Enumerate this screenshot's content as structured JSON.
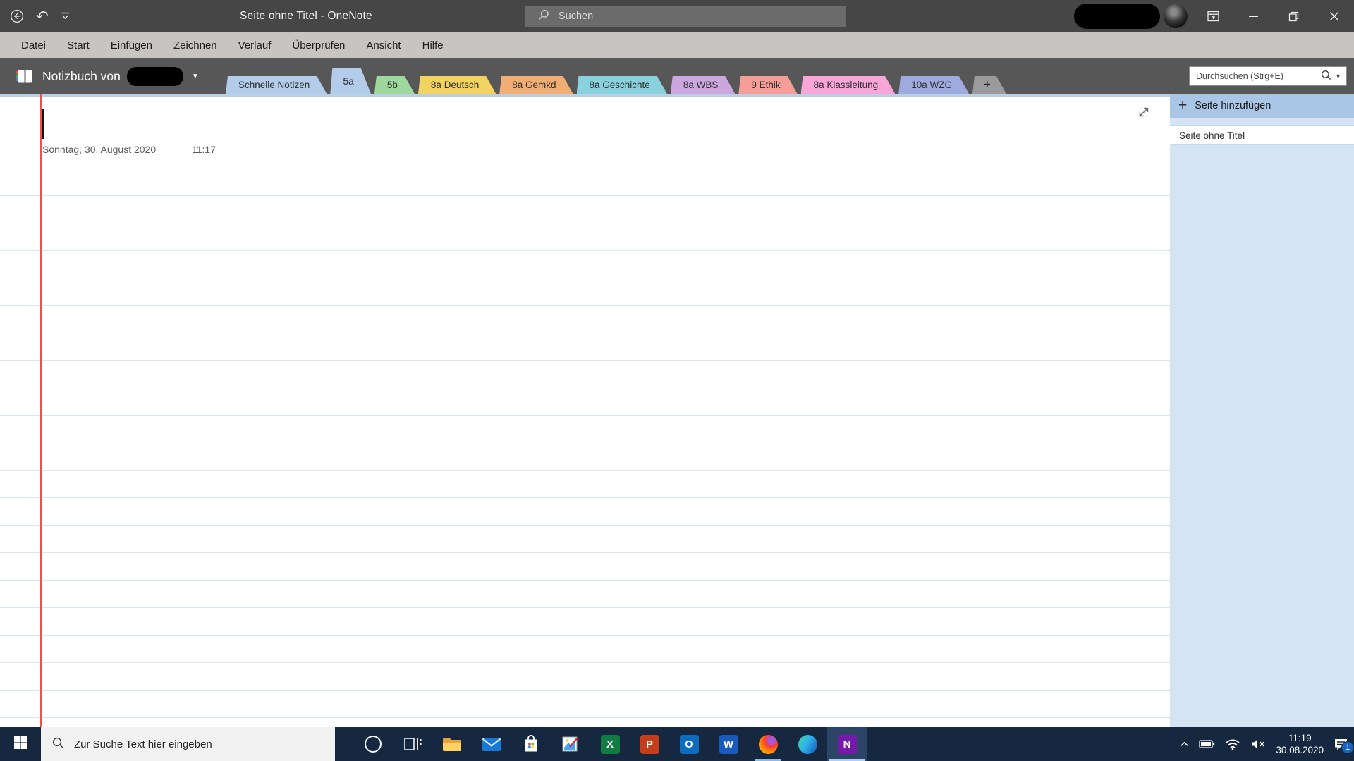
{
  "titlebar": {
    "title": "Seite ohne Titel  -  OneNote",
    "search_placeholder": "Suchen"
  },
  "menubar": {
    "items": [
      "Datei",
      "Start",
      "Einfügen",
      "Zeichnen",
      "Verlauf",
      "Überprüfen",
      "Ansicht",
      "Hilfe"
    ]
  },
  "notebook_bar": {
    "label": "Notizbuch von",
    "tabs": [
      {
        "label": "Schnelle Notizen",
        "color": "#b3cce9",
        "active": false
      },
      {
        "label": "5a",
        "color": "#b3cce9",
        "active": true
      },
      {
        "label": "5b",
        "color": "#9fd89f",
        "active": false
      },
      {
        "label": "8a Deutsch",
        "color": "#f2d260",
        "active": false
      },
      {
        "label": "8a Gemkd",
        "color": "#f1ae74",
        "active": false
      },
      {
        "label": "8a Geschichte",
        "color": "#8ad1de",
        "active": false
      },
      {
        "label": "8a WBS",
        "color": "#cca6de",
        "active": false
      },
      {
        "label": "9 Ethik",
        "color": "#f59e98",
        "active": false
      },
      {
        "label": "8a Klassleitung",
        "color": "#f7a6d7",
        "active": false
      },
      {
        "label": "10a WZG",
        "color": "#9fabdf",
        "active": false
      }
    ],
    "add_tab_label": "+",
    "page_search_placeholder": "Durchsuchen (Strg+E)"
  },
  "page": {
    "date": "Sonntag, 30. August 2020",
    "time": "11:17"
  },
  "sidebar": {
    "add_page_label": "Seite hinzufügen",
    "pages": [
      {
        "title": "Seite ohne Titel"
      }
    ]
  },
  "taskbar": {
    "search_placeholder": "Zur Suche Text hier eingeben",
    "apps": [
      {
        "name": "cortana"
      },
      {
        "name": "task-view"
      },
      {
        "name": "file-explorer"
      },
      {
        "name": "mail"
      },
      {
        "name": "microsoft-store"
      },
      {
        "name": "paint"
      },
      {
        "name": "excel",
        "glyph": "X"
      },
      {
        "name": "powerpoint",
        "glyph": "P"
      },
      {
        "name": "outlook",
        "glyph": "O"
      },
      {
        "name": "word",
        "glyph": "W"
      },
      {
        "name": "firefox",
        "running": true
      },
      {
        "name": "edge"
      },
      {
        "name": "onenote",
        "glyph": "N",
        "active": true
      }
    ],
    "tray": {
      "time": "11:19",
      "date": "30.08.2020",
      "notification_count": "1"
    }
  },
  "colors": {
    "accent_strip": "#b7d0ea",
    "ruled_line": "#d4e7f4",
    "margin_line": "#e8534e"
  }
}
